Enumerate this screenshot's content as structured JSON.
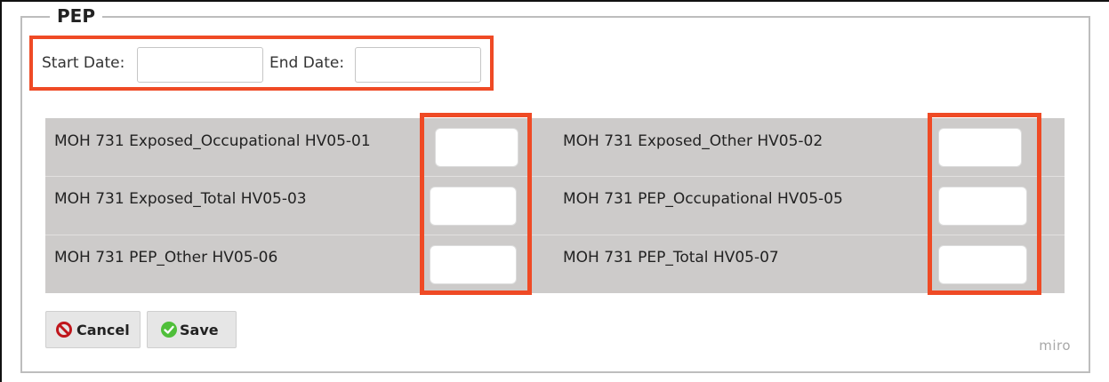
{
  "section": {
    "legend": "PEP"
  },
  "dates": {
    "start_label": "Start Date:",
    "start_value": "",
    "end_label": "End Date:",
    "end_value": ""
  },
  "indicators": [
    {
      "label": "MOH 731 Exposed_Occupational HV05-01",
      "value": ""
    },
    {
      "label": "MOH 731 Exposed_Other HV05-02",
      "value": ""
    },
    {
      "label": "MOH 731 Exposed_Total HV05-03",
      "value": ""
    },
    {
      "label": "MOH 731 PEP_Occupational HV05-05",
      "value": ""
    },
    {
      "label": "MOH 731 PEP_Other HV05-06",
      "value": ""
    },
    {
      "label": "MOH 731 PEP_Total HV05-07",
      "value": ""
    }
  ],
  "buttons": {
    "cancel": "Cancel",
    "save": "Save"
  },
  "icons": {
    "cancel": "prohibited-icon",
    "save": "check-circle-icon"
  },
  "colors": {
    "highlight": "#ef4a25",
    "grid_bg": "#cdcbca",
    "save_icon": "#4fbf3a",
    "cancel_icon": "#c0161c"
  },
  "watermark": "miro"
}
